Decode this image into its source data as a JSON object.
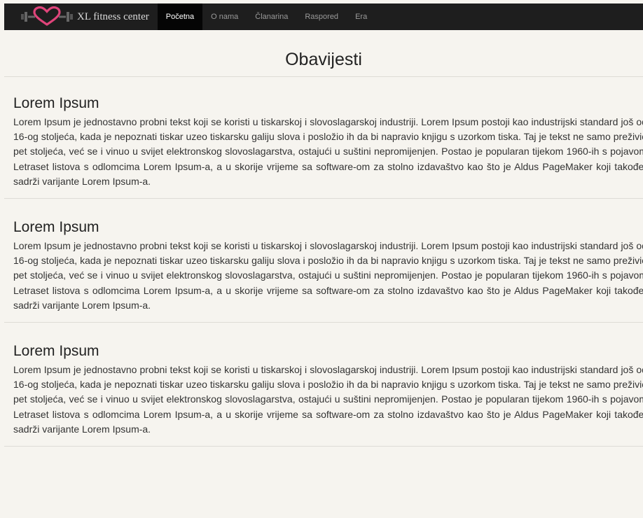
{
  "brand": {
    "logo_icon": "heart-dumbbell-logo",
    "name": "XL fitness center"
  },
  "nav": {
    "items": [
      {
        "label": "Početna",
        "active": true
      },
      {
        "label": "O nama",
        "active": false
      },
      {
        "label": "Članarina",
        "active": false
      },
      {
        "label": "Raspored",
        "active": false
      },
      {
        "label": "Era",
        "active": false
      }
    ]
  },
  "page": {
    "title": "Obavijesti"
  },
  "posts": [
    {
      "title": "Lorem Ipsum",
      "body": "Lorem Ipsum je jednostavno probni tekst koji se koristi u tiskarskoj i slovoslagarskoj industriji. Lorem Ipsum postoji kao industrijski standard još od 16-og stoljeća, kada je nepoznati tiskar uzeo tiskarsku galiju slova i posložio ih da bi napravio knjigu s uzorkom tiska. Taj je tekst ne samo preživio pet stoljeća, već se i vinuo u svijet elektronskog slovoslagarstva, ostajući u suštini nepromijenjen. Postao je popularan tijekom 1960-ih s pojavom Letraset listova s odlomcima Lorem Ipsum-a, a u skorije vrijeme sa software-om za stolno izdavaštvo kao što je Aldus PageMaker koji također sadrži varijante Lorem Ipsum-a."
    },
    {
      "title": "Lorem Ipsum",
      "body": "Lorem Ipsum je jednostavno probni tekst koji se koristi u tiskarskoj i slovoslagarskoj industriji. Lorem Ipsum postoji kao industrijski standard još od 16-og stoljeća, kada je nepoznati tiskar uzeo tiskarsku galiju slova i posložio ih da bi napravio knjigu s uzorkom tiska. Taj je tekst ne samo preživio pet stoljeća, već se i vinuo u svijet elektronskog slovoslagarstva, ostajući u suštini nepromijenjen. Postao je popularan tijekom 1960-ih s pojavom Letraset listova s odlomcima Lorem Ipsum-a, a u skorije vrijeme sa software-om za stolno izdavaštvo kao što je Aldus PageMaker koji također sadrži varijante Lorem Ipsum-a."
    },
    {
      "title": "Lorem Ipsum",
      "body": "Lorem Ipsum je jednostavno probni tekst koji se koristi u tiskarskoj i slovoslagarskoj industriji. Lorem Ipsum postoji kao industrijski standard još od 16-og stoljeća, kada je nepoznati tiskar uzeo tiskarsku galiju slova i posložio ih da bi napravio knjigu s uzorkom tiska. Taj je tekst ne samo preživio pet stoljeća, već se i vinuo u svijet elektronskog slovoslagarstva, ostajući u suštini nepromijenjen. Postao je popularan tijekom 1960-ih s pojavom Letraset listova s odlomcima Lorem Ipsum-a, a u skorije vrijeme sa software-om za stolno izdavaštvo kao što je Aldus PageMaker koji također sadrži varijante Lorem Ipsum-a."
    }
  ],
  "colors": {
    "navbar": "#1e1e1e",
    "nav_active": "#050505",
    "background": "#f6f4ef",
    "logo_heart": "#e0447a"
  }
}
